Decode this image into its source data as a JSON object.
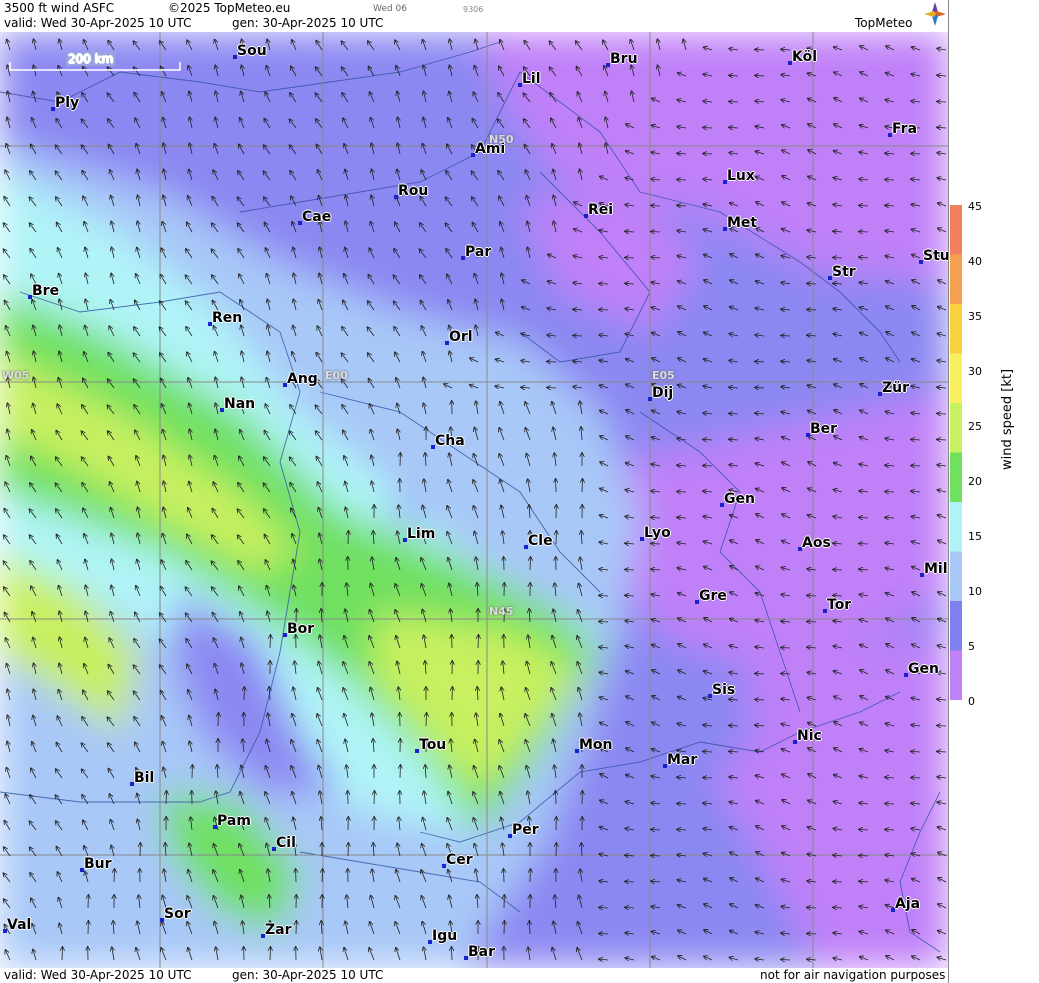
{
  "header": {
    "product": "3500 ft wind ASFC",
    "copyright": "©2025 TopMeteo.eu",
    "day": "Wed 06",
    "code": "9306",
    "valid": "valid:  Wed  30-Apr-2025  10 UTC",
    "gen": "gen:  30-Apr-2025  10 UTC",
    "brand": "TopMeteo"
  },
  "footer": {
    "valid": "valid:  Wed  30-Apr-2025  10 UTC",
    "gen": "gen:  30-Apr-2025  10 UTC",
    "disclaimer": "not for air navigation purposes"
  },
  "scale_bar": {
    "label": "200 km"
  },
  "colorbar": {
    "title": "wind  speed  [kt]",
    "ticks": [
      "45",
      "40",
      "35",
      "30",
      "25",
      "20",
      "15",
      "10",
      "5",
      "0"
    ],
    "colors": [
      "#f08060",
      "#f5a050",
      "#f8d040",
      "#f8f060",
      "#c8f060",
      "#70e060",
      "#b0f4f8",
      "#a8c8f8",
      "#8080f0",
      "#c080f8"
    ]
  },
  "grid_labels": [
    "N50",
    "W05",
    "E00",
    "E05",
    "N45"
  ],
  "cities": [
    "Sou",
    "Bru",
    "Köl",
    "Lil",
    "Ply",
    "Fra",
    "Ami",
    "Lux",
    "Rou",
    "Cae",
    "Rei",
    "Met",
    "Par",
    "Stu",
    "Bre",
    "Str",
    "Ren",
    "Orl",
    "Ang",
    "E00",
    "Zür",
    "Nan",
    "Dij",
    "Ber",
    "Cha",
    "Gen",
    "Lim",
    "Cle",
    "Lyo",
    "Aos",
    "Mil",
    "Gre",
    "Tor",
    "Bor",
    "Gen",
    "Sis",
    "Tou",
    "Mon",
    "Nic",
    "Mar",
    "Bil",
    "Pam",
    "Cil",
    "Per",
    "Bur",
    "Cer",
    "Sor",
    "Aja",
    "Val",
    "Zar",
    "Igu",
    "Bar"
  ]
}
